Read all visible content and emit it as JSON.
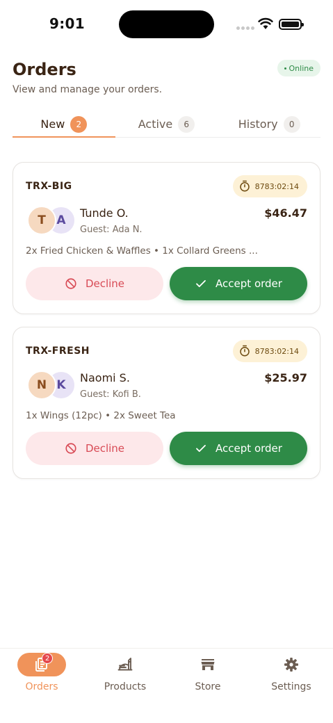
{
  "status_bar": {
    "time": "9:01"
  },
  "header": {
    "title": "Orders",
    "subtitle": "View and manage your orders.",
    "online_label": "Online"
  },
  "tabs": [
    {
      "label": "New",
      "count": "2",
      "active": true
    },
    {
      "label": "Active",
      "count": "6",
      "active": false
    },
    {
      "label": "History",
      "count": "0",
      "active": false
    }
  ],
  "orders": [
    {
      "id": "TRX-BIG",
      "timer": "8783:02:14",
      "customer": "Tunde O.",
      "initials": [
        "T",
        "A"
      ],
      "guest": "Guest: Ada N.",
      "total": "$46.47",
      "items": "2x Fried Chicken & Waffles • 1x Collard Greens ...",
      "decline_label": "Decline",
      "accept_label": "Accept order"
    },
    {
      "id": "TRX-FRESH",
      "timer": "8783:02:14",
      "customer": "Naomi S.",
      "initials": [
        "N",
        "K"
      ],
      "guest": "Guest: Kofi B.",
      "total": "$25.97",
      "items": "1x Wings (12pc) • 2x Sweet Tea",
      "decline_label": "Decline",
      "accept_label": "Accept order"
    }
  ],
  "bottom_nav": [
    {
      "label": "Orders",
      "icon": "orders-icon",
      "badge": "2",
      "active": true
    },
    {
      "label": "Products",
      "icon": "products-icon",
      "active": false
    },
    {
      "label": "Store",
      "icon": "store-icon",
      "active": false
    },
    {
      "label": "Settings",
      "icon": "gear-icon",
      "active": false
    }
  ],
  "colors": {
    "accent": "#f0935a",
    "accept": "#2e8b47",
    "decline_bg": "#fde8ea",
    "decline_text": "#d84a55",
    "timer_bg": "#fdf1d6",
    "online_bg": "#e7f5ea",
    "badge": "#e5484d"
  }
}
